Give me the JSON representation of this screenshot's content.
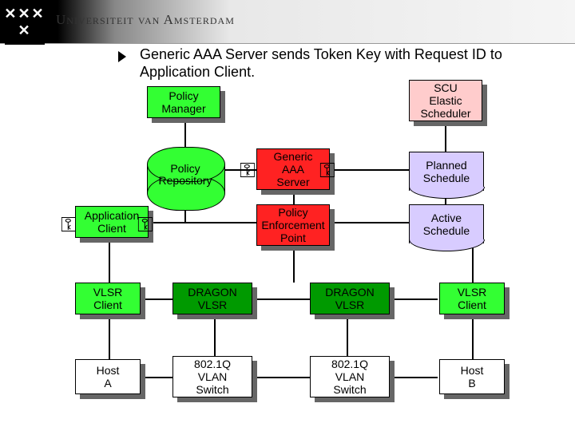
{
  "header": {
    "university": "Universiteit van Amsterdam",
    "logo_top": "X̄X̄",
    "logo_bot": "X̄"
  },
  "title": "Generic AAA Server sends Token Key with Request ID to Application Client.",
  "nodes": {
    "policy_manager": "Policy\nManager",
    "scu": "SCU\nElastic\nScheduler",
    "policy_repo": "Policy\nRepository",
    "aaa": "Generic\nAAA\nServer",
    "planned": "Planned\nSchedule",
    "app_client": "Application\nClient",
    "pep": "Policy\nEnforcement\nPoint",
    "active": "Active\nSchedule",
    "vlsr_client_l": "VLSR\nClient",
    "dragon_l": "DRAGON\nVLSR",
    "dragon_r": "DRAGON\nVLSR",
    "vlsr_client_r": "VLSR\nClient",
    "host_a": "Host\nA",
    "switch_l": "802.1Q\nVLAN\nSwitch",
    "switch_r": "802.1Q\nVLAN\nSwitch",
    "host_b": "Host\nB"
  }
}
